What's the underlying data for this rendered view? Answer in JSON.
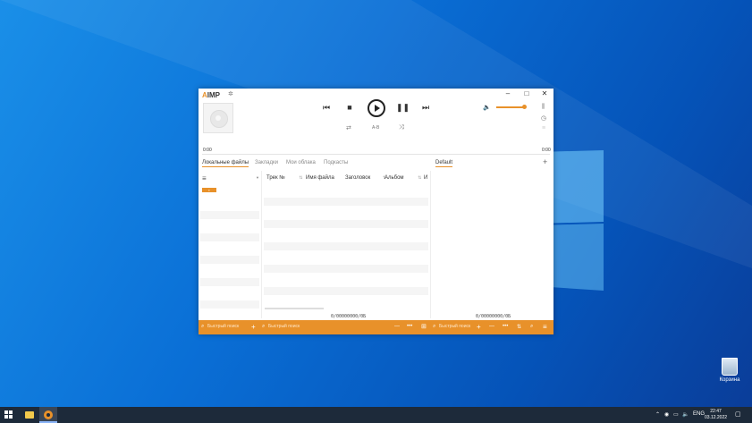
{
  "desktop": {
    "recycle_bin_label": "Корзина"
  },
  "player": {
    "logo_prefix": "A",
    "logo_suffix": "IMP",
    "window_controls": {
      "minimize": "–",
      "maximize": "□",
      "close": "✕"
    },
    "ab_label": "A-B",
    "time_elapsed": "0:00",
    "time_total": "0:00"
  },
  "library": {
    "tabs": [
      "Локальные файлы",
      "Закладки",
      "Мои облака",
      "Подкасты"
    ],
    "active_tab": "Локальные файлы",
    "columns": [
      "Трек №",
      "Имя файла",
      "Заголовок",
      "Альбом",
      "И"
    ],
    "status": "0/00000000/0Б",
    "search_placeholder": "Быстрый поиск"
  },
  "playlist": {
    "name": "Default",
    "add_label": "+",
    "status": "0/00000000/0Б",
    "search_placeholder": "Быстрый поиск"
  },
  "taskbar": {
    "language": "ENG",
    "time": "22:47",
    "date": "03.12.2022"
  },
  "colors": {
    "accent": "#e8912a",
    "taskbar": "#1d2a3a",
    "desktop": "#0a6fd6"
  }
}
